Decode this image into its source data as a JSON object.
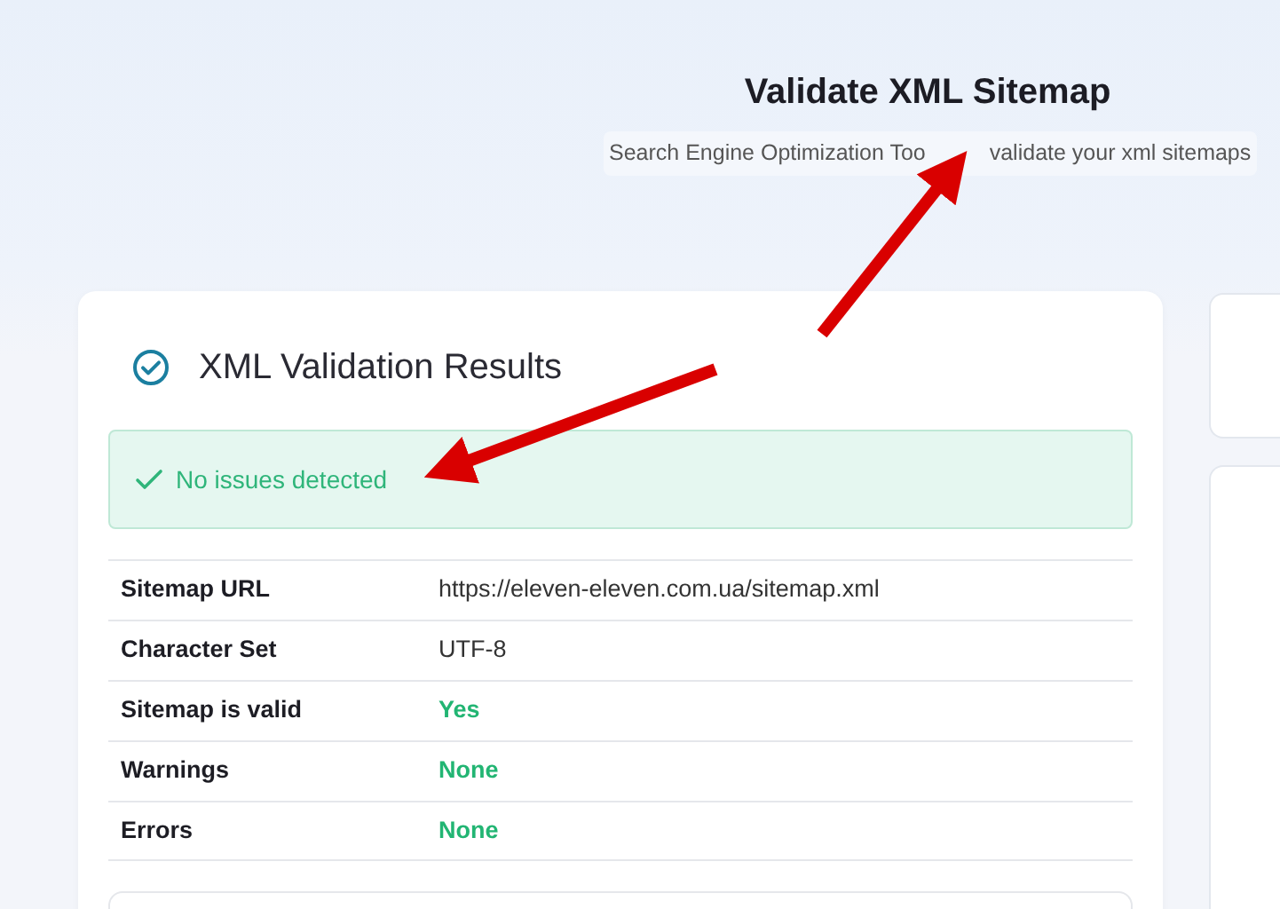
{
  "header": {
    "title": "Validate XML Sitemap",
    "subtitle_parts": [
      "Search Engine Optimization Too",
      "validate your xml sitemaps"
    ]
  },
  "results": {
    "title": "XML Validation Results",
    "alert": {
      "kind": "success",
      "text": "No issues detected"
    },
    "rows": [
      {
        "label": "Sitemap URL",
        "value": "https://eleven-eleven.com.ua/sitemap.xml",
        "kind": "plain"
      },
      {
        "label": "Character Set",
        "value": "UTF-8",
        "kind": "plain"
      },
      {
        "label": "Sitemap is valid",
        "value": "Yes",
        "kind": "positive"
      },
      {
        "label": "Warnings",
        "value": "None",
        "kind": "positive"
      },
      {
        "label": "Errors",
        "value": "None",
        "kind": "positive"
      }
    ]
  }
}
